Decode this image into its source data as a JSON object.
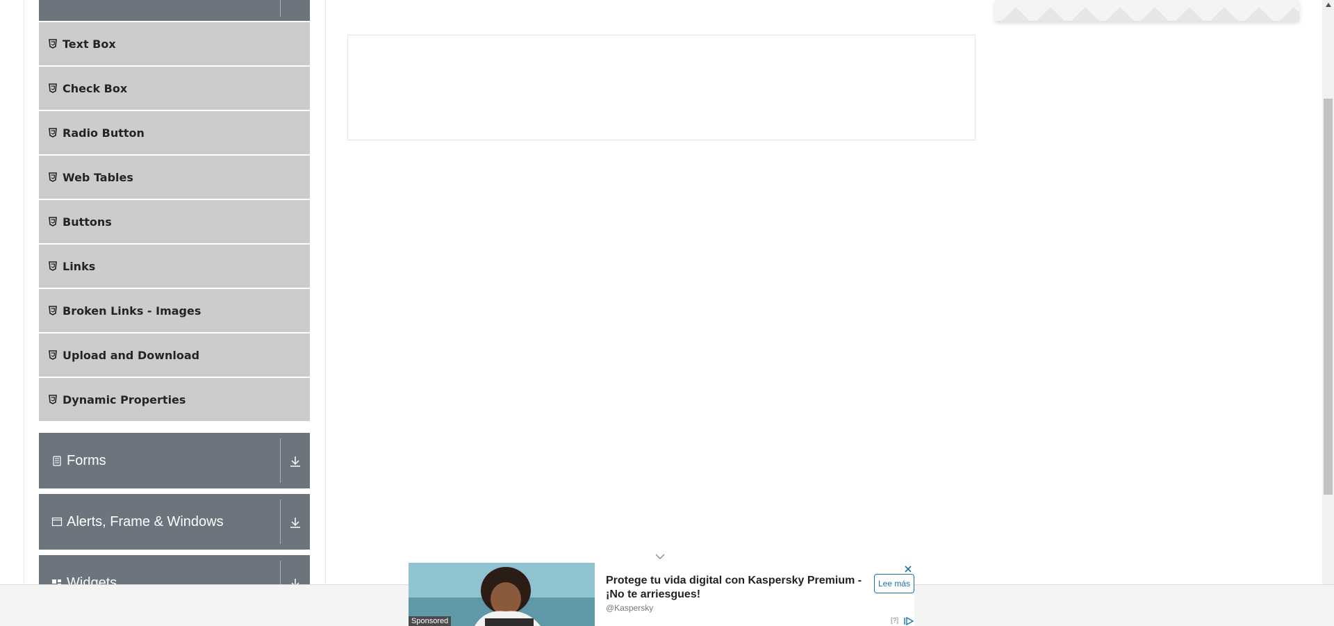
{
  "sidebar": {
    "elements_items": [
      {
        "label": "Text Box"
      },
      {
        "label": "Check Box"
      },
      {
        "label": "Radio Button"
      },
      {
        "label": "Web Tables"
      },
      {
        "label": "Buttons"
      },
      {
        "label": "Links"
      },
      {
        "label": "Broken Links - Images"
      },
      {
        "label": "Upload and Download"
      },
      {
        "label": "Dynamic Properties"
      }
    ],
    "groups": [
      {
        "title": "Forms",
        "icon": "form-icon"
      },
      {
        "title": "Alerts, Frame & Windows",
        "icon": "window-icon"
      },
      {
        "title": "Widgets",
        "icon": "widgets-icon"
      }
    ]
  },
  "ad": {
    "headline": "Protege tu vida digital con Kaspersky Premium - ¡No te arriesgues!",
    "handle": "@Kaspersky",
    "cta": "Lee más",
    "sponsored": "Sponsored",
    "info": "[?]"
  },
  "colors": {
    "group_header_bg": "#6c757d",
    "menu_item_bg": "#cccccc",
    "ad_accent": "#1a73a8"
  }
}
